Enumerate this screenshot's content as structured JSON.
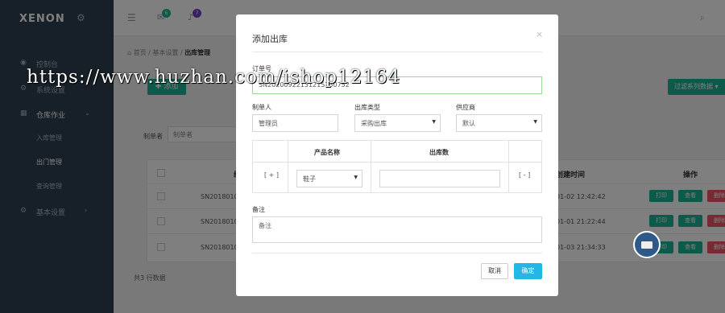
{
  "app": {
    "brand": "XENON",
    "brand_icon": "gear-icon"
  },
  "sidebar": {
    "items": [
      {
        "label": "控制台",
        "icon": "dashboard-icon"
      },
      {
        "label": "系统设置",
        "icon": "gear-icon"
      },
      {
        "label": "仓库作业",
        "icon": "warehouse-icon",
        "expanded": true,
        "children": [
          "入库管理",
          "出门管理",
          "查询管理"
        ],
        "active_child": 1
      },
      {
        "label": "基本设置",
        "icon": "gear-icon"
      }
    ]
  },
  "topbar": {
    "mail_count": "6",
    "bell_count": "7",
    "mail_color": "#1ab394",
    "bell_color": "#6f42c1"
  },
  "breadcrumb": {
    "home": "首页",
    "mid": "基本设置",
    "current": "出库管理"
  },
  "content": {
    "add_button": "✚ 添加",
    "filter_button": "过滤系列数据 ▾",
    "filter_label": "制单者",
    "filter_placeholder": "制单者",
    "table": {
      "headers": [
        "编号",
        "创建时间",
        "操作"
      ],
      "rows": [
        {
          "id": "SN2018010",
          "time": "01-02 12:42:42"
        },
        {
          "id": "SN2018010",
          "time": "01-01 21:22:44"
        },
        {
          "id": "SN2018010",
          "time": "01-03 21:34:33"
        }
      ],
      "actions": [
        "打印",
        "查看",
        "删除"
      ]
    },
    "total": "共3 行数据"
  },
  "modal": {
    "title": "添加出库",
    "close": "×",
    "order_label": "订单号",
    "order_value": "SN20200922131215750752",
    "creator_label": "制单人",
    "creator_value": "管理员",
    "type_label": "出库类型",
    "type_value": "采购出库",
    "supplier_label": "供应商",
    "supplier_value": "默认",
    "product_table": {
      "headers": [
        "产品名称",
        "出库数"
      ],
      "add": "[ + ]",
      "remove": "[ - ]",
      "product_value": "鞋子",
      "quantity_value": ""
    },
    "remark_label": "备注",
    "remark_placeholder": "备注",
    "cancel": "取消",
    "confirm": "确定"
  },
  "watermark": "https://www.huzhan.com/ishop12164"
}
